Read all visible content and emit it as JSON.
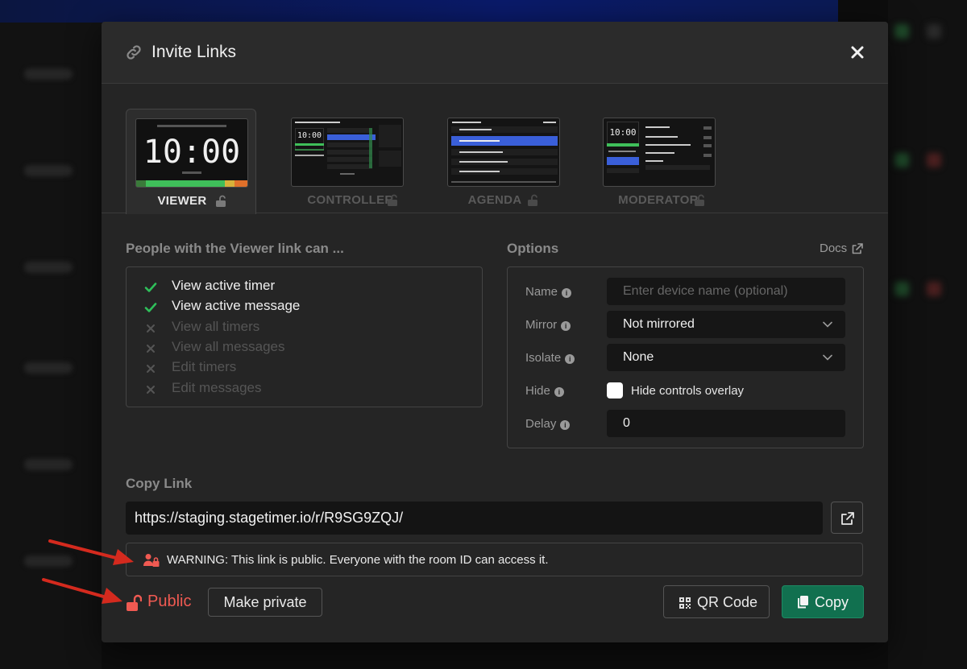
{
  "modal": {
    "title": "Invite Links",
    "icon": "link-icon",
    "close_icon": "close-icon"
  },
  "tabs": [
    {
      "label": "VIEWER",
      "active": true,
      "locked": false,
      "thumb_time": "10:00"
    },
    {
      "label": "CONTROLLER",
      "active": false,
      "locked": false,
      "thumb_time": "10:00"
    },
    {
      "label": "AGENDA",
      "active": false,
      "locked": false
    },
    {
      "label": "MODERATOR",
      "active": false,
      "locked": false,
      "thumb_time": "10:00"
    }
  ],
  "permissions": {
    "title": "People with the Viewer link can ...",
    "items": [
      {
        "label": "View active timer",
        "allowed": true
      },
      {
        "label": "View active message",
        "allowed": true
      },
      {
        "label": "View all timers",
        "allowed": false
      },
      {
        "label": "View all messages",
        "allowed": false
      },
      {
        "label": "Edit timers",
        "allowed": false
      },
      {
        "label": "Edit messages",
        "allowed": false
      }
    ]
  },
  "options": {
    "title": "Options",
    "docs_label": "Docs",
    "name": {
      "label": "Name",
      "placeholder": "Enter device name (optional)",
      "value": ""
    },
    "mirror": {
      "label": "Mirror",
      "value": "Not mirrored"
    },
    "isolate": {
      "label": "Isolate",
      "value": "None"
    },
    "hide": {
      "label": "Hide",
      "checkbox_label": "Hide controls overlay",
      "checked": false
    },
    "delay": {
      "label": "Delay",
      "value": "0"
    }
  },
  "copy_link": {
    "title": "Copy Link",
    "url": "https://staging.stagetimer.io/r/R9SG9ZQJ/"
  },
  "warning": {
    "text": "WARNING: This link is public. Everyone with the room ID can access it."
  },
  "footer": {
    "status": "Public",
    "make_private": "Make private",
    "qr_code": "QR Code",
    "copy": "Copy"
  },
  "colors": {
    "accent_green": "#11704f",
    "public_red": "#f05a52",
    "check_green": "#2fbf5a",
    "arrow_red": "#d42a1e"
  }
}
